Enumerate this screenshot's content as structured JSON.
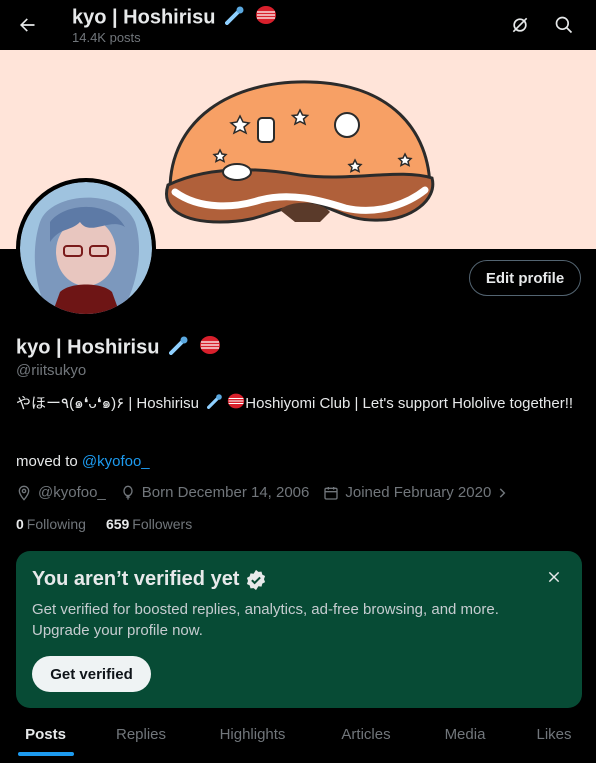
{
  "header": {
    "title": "kyo | Hoshirisu",
    "post_count": "14.4K posts"
  },
  "profile": {
    "name": "kyo | Hoshirisu",
    "handle": "@riitsukyo",
    "edit_button": "Edit profile",
    "bio_part1": "やほー٩(๑❛ᴗ❛๑)۶ | Hoshirisu",
    "bio_part2": "Hoshiyomi Club | Let's support Hololive together!!",
    "moved_prefix": "moved to ",
    "moved_link": "@kyofoo_",
    "location": "@kyofoo_",
    "birthday": "Born December 14, 2006",
    "joined": "Joined February 2020",
    "following_count": "0",
    "following_label": "Following",
    "followers_count": "659",
    "followers_label": "Followers"
  },
  "verify_card": {
    "title": "You aren’t verified yet",
    "text": "Get verified for boosted replies, analytics, ad-free browsing, and more. Upgrade your profile now.",
    "button": "Get verified"
  },
  "tabs": [
    {
      "label": "Posts",
      "active": true
    },
    {
      "label": "Replies"
    },
    {
      "label": "Highlights"
    },
    {
      "label": "Articles"
    },
    {
      "label": "Media"
    },
    {
      "label": "Likes"
    }
  ],
  "colors": {
    "accent": "#1d9bf0",
    "verify_card_bg": "#074b35",
    "banner_bg": "#ffe4d9"
  }
}
